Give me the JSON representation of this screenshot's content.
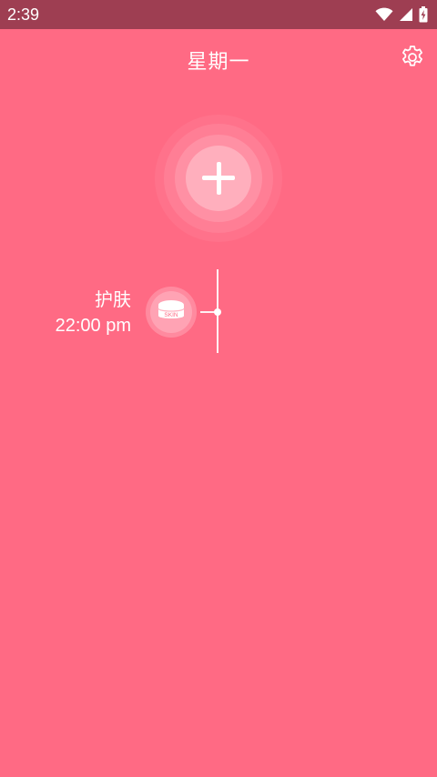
{
  "status_bar": {
    "time": "2:39",
    "icons": [
      "wifi-icon",
      "cellular-signal-icon",
      "battery-charging-icon"
    ]
  },
  "header": {
    "title": "星期一",
    "settings_icon": "gear-icon"
  },
  "add_button": {
    "icon": "plus-icon"
  },
  "timeline": {
    "items": [
      {
        "name": "护肤",
        "time": "22:00 pm",
        "icon": "skin-cream-jar-icon",
        "icon_label": "SKIN"
      }
    ]
  },
  "colors": {
    "background": "#ff6a84",
    "status_bar": "#9e3e52",
    "foreground": "#ffffff"
  }
}
